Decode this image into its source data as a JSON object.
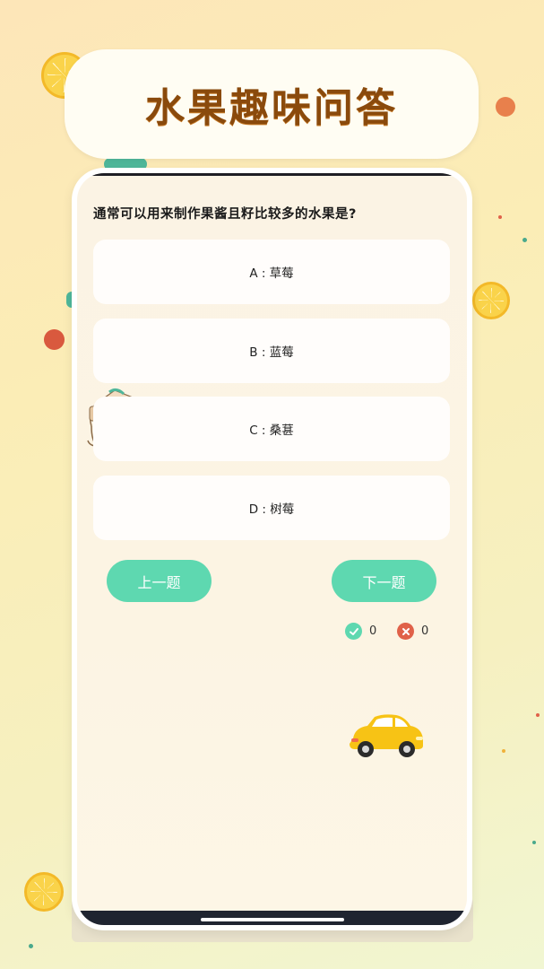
{
  "title": "水果趣味问答",
  "quiz": {
    "question": "通常可以用来制作果酱且籽比较多的水果是?",
    "options": [
      {
        "label": "A : 草莓"
      },
      {
        "label": "B : 蓝莓"
      },
      {
        "label": "C : 桑葚"
      },
      {
        "label": "D : 树莓"
      }
    ],
    "prev_label": "上一题",
    "next_label": "下一题",
    "correct_count": "0",
    "wrong_count": "0"
  },
  "colors": {
    "accent": "#5ed8b0",
    "title_text": "#8a4a0c",
    "correct": "#5ed8b0",
    "wrong": "#e06149"
  },
  "icons": [
    "check-circle-icon",
    "cross-circle-icon",
    "lemon-slice-icon",
    "car-icon",
    "bag-icon"
  ]
}
